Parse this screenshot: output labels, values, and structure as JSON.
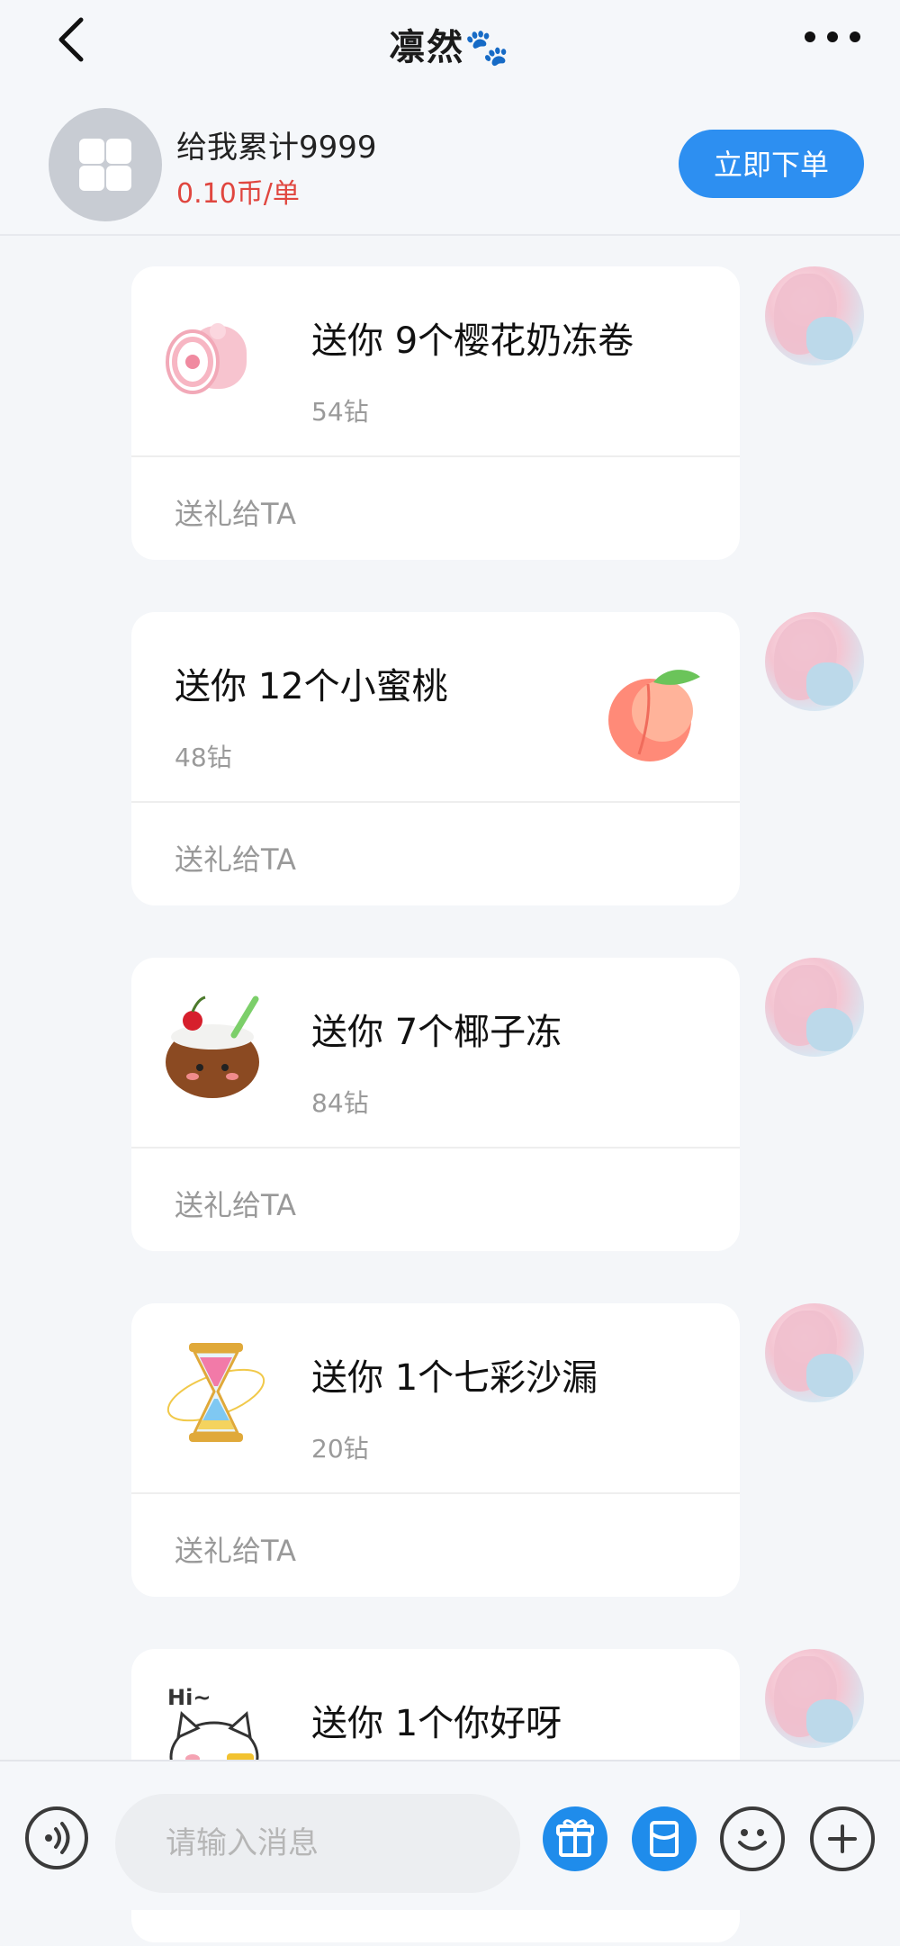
{
  "header": {
    "title": "凛然🐾",
    "back_icon": "chevron-left-icon",
    "more_icon": "more-horizontal-icon"
  },
  "order": {
    "icon": "apps-grid-icon",
    "name": "给我累计9999",
    "price": "0.10币/单",
    "button_label": "立即下单"
  },
  "messages": [
    {
      "gift_title": "送你 9个樱花奶冻卷",
      "price": "54钻",
      "send_label": "送礼给TA",
      "gift_icon": "sakura-roll-cake-icon"
    },
    {
      "gift_title": "送你 12个小蜜桃",
      "price": "48钻",
      "send_label": "送礼给TA",
      "gift_icon": "peach-icon"
    },
    {
      "gift_title": "送你 7个椰子冻",
      "price": "84钻",
      "send_label": "送礼给TA",
      "gift_icon": "coconut-drink-icon"
    },
    {
      "gift_title": "送你 1个七彩沙漏",
      "price": "20钻",
      "send_label": "送礼给TA",
      "gift_icon": "rainbow-hourglass-icon"
    },
    {
      "gift_title": "送你 1个你好呀",
      "gift_icon": "hi-cat-sticker-icon",
      "sticker_text": "Hi~"
    }
  ],
  "input": {
    "placeholder": "请输入消息"
  },
  "toolbar": {
    "voice_icon": "voice-icon",
    "gift_icon": "gift-icon",
    "redpacket_icon": "red-packet-icon",
    "emoji_icon": "emoji-icon",
    "plus_icon": "plus-icon",
    "accent_color": "#1f8ceb"
  }
}
